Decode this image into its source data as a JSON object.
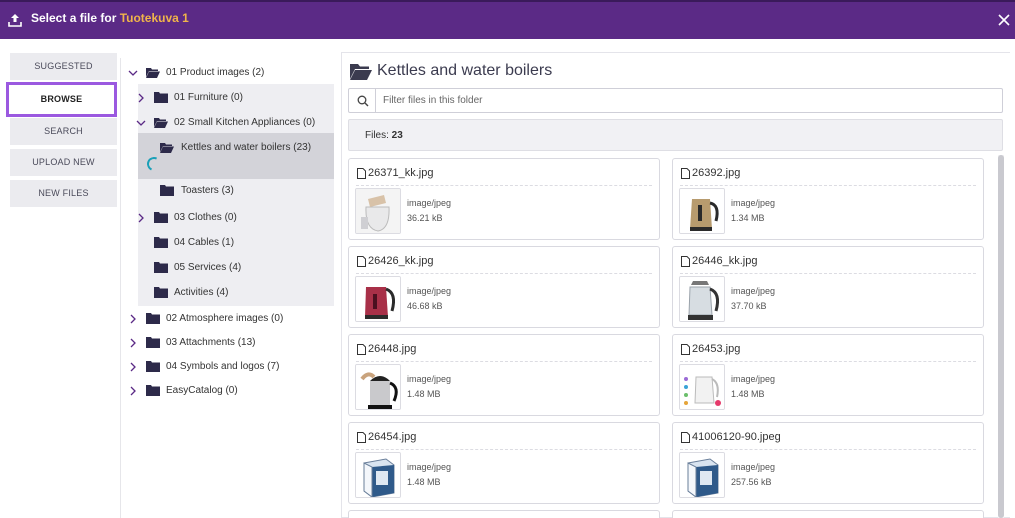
{
  "header": {
    "title_prefix": "Select a file for ",
    "title_target": "Tuotekuva 1",
    "bg_color": "#5b2a86",
    "accent_color": "#f0b44a"
  },
  "tabs": [
    {
      "label": "SUGGESTED",
      "active": false
    },
    {
      "label": "BROWSE",
      "active": true
    },
    {
      "label": "SEARCH",
      "active": false
    },
    {
      "label": "UPLOAD NEW",
      "active": false
    },
    {
      "label": "NEW FILES",
      "active": false
    }
  ],
  "tree": {
    "product_images": "01 Product images (2)",
    "furniture": "01 Furniture (0)",
    "small_kitchen": "02 Small Kitchen Appliances (0)",
    "kettles": "Kettles and water boilers (23)",
    "toasters": "Toasters (3)",
    "clothes": "03 Clothes (0)",
    "cables": "04 Cables (1)",
    "services": "05 Services (4)",
    "activities": "Activities (4)",
    "atmosphere": "02 Atmosphere images (0)",
    "attachments": "03 Attachments (13)",
    "symbols": "04 Symbols and logos (7)",
    "easycatalog": "EasyCatalog (0)"
  },
  "folder": {
    "title": "Kettles and water boilers",
    "search_placeholder": "Filter files in this folder",
    "files_label": "Files: ",
    "files_count": "23"
  },
  "files": [
    {
      "name": "26371_kk.jpg",
      "mime": "image/jpeg",
      "size": "36.21 kB",
      "thumb": "white-kettle-hand-icon"
    },
    {
      "name": "26392.jpg",
      "mime": "image/jpeg",
      "size": "1.34 MB",
      "thumb": "gold-kettle-icon"
    },
    {
      "name": "26426_kk.jpg",
      "mime": "image/jpeg",
      "size": "46.68 kB",
      "thumb": "red-kettle-icon"
    },
    {
      "name": "26446_kk.jpg",
      "mime": "image/jpeg",
      "size": "37.70 kB",
      "thumb": "glass-kettle-icon"
    },
    {
      "name": "26448.jpg",
      "mime": "image/jpeg",
      "size": "1.48 MB",
      "thumb": "black-kettle-icon"
    },
    {
      "name": "26453.jpg",
      "mime": "image/jpeg",
      "size": "1.48 MB",
      "thumb": "white-kettle-dots-icon"
    },
    {
      "name": "26454.jpg",
      "mime": "image/jpeg",
      "size": "1.48 MB",
      "thumb": "kettle-box-icon"
    },
    {
      "name": "41006120-90.jpeg",
      "mime": "image/jpeg",
      "size": "257.56 kB",
      "thumb": "kettle-box-icon"
    }
  ]
}
